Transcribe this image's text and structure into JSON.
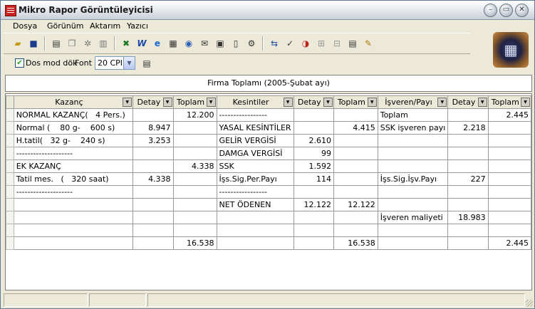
{
  "window": {
    "title": "Mikro Rapor Görüntüleyicisi"
  },
  "menu": [
    {
      "label": "Dosya"
    },
    {
      "label": "Görünüm"
    },
    {
      "label": "Aktarım"
    },
    {
      "label": "Yazıcı"
    }
  ],
  "toolbar": {
    "dos_checkbox_label": "Dos mod dök",
    "dos_checked": true,
    "font_label": "Font",
    "font_value": "20 CPI"
  },
  "report": {
    "caption": "Firma Toplamı (2005-Şubat ayı)",
    "columns": [
      "Kazanç",
      "Detay",
      "Toplam",
      "Kesintiler",
      "Detay",
      "Toplam",
      "İşveren/Payı",
      "Detay",
      "Toplam"
    ],
    "rows": [
      [
        "NORMAL KAZANÇ(   4 Pers.)",
        "",
        "12.200",
        "-----------------",
        "",
        "",
        "Toplam",
        "",
        "2.445"
      ],
      [
        "Normal (    80 g-    600 s)",
        "8.947",
        "",
        "YASAL KESİNTİLER",
        "",
        "4.415",
        "SSK işveren payı",
        "2.218",
        ""
      ],
      [
        "H.tatil(   32 g-    240 s)",
        "3.253",
        "",
        "GELİR VERGİSİ",
        "2.610",
        "",
        "",
        "",
        ""
      ],
      [
        "--------------------",
        "",
        "",
        "DAMGA VERGİSİ",
        "99",
        "",
        "",
        "",
        ""
      ],
      [
        "EK KAZANÇ",
        "",
        "4.338",
        "SSK",
        "1.592",
        "",
        "",
        "",
        ""
      ],
      [
        "Tatil mes.   (   320 saat)",
        "4.338",
        "",
        "İşs.Sig.Per.Payı",
        "114",
        "",
        "İşs.Sig.İşv.Payı",
        "227",
        ""
      ],
      [
        "--------------------",
        "",
        "",
        "-----------------",
        "",
        "",
        "",
        "",
        ""
      ],
      [
        "",
        "",
        "",
        "NET ÖDENEN",
        "12.122",
        "12.122",
        "",
        "",
        ""
      ],
      [
        "",
        "",
        "",
        "",
        "",
        "",
        "İşveren maliyeti",
        "18.983",
        ""
      ],
      [
        "",
        "",
        "",
        "",
        "",
        "",
        "",
        "",
        ""
      ],
      [
        "",
        "",
        "16.538",
        "",
        "",
        "16.538",
        "",
        "",
        "2.445"
      ]
    ]
  }
}
